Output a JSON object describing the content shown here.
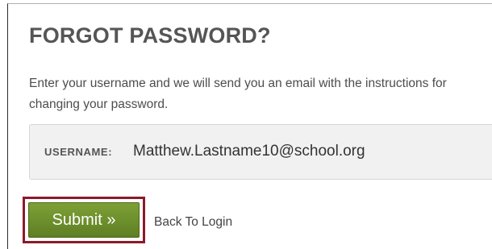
{
  "form": {
    "title": "FORGOT PASSWORD?",
    "instructions": "Enter your username and we will send you an email with the instructions for changing your password.",
    "username_label": "USERNAME:",
    "username_value": "Matthew.Lastname10@school.org",
    "submit_label": "Submit »",
    "back_link_label": "Back To Login"
  },
  "colors": {
    "submit_button": "#6b8e2a",
    "highlight_border": "#8b1a2a",
    "field_background": "#f1f1f1",
    "title_text": "#555555"
  }
}
